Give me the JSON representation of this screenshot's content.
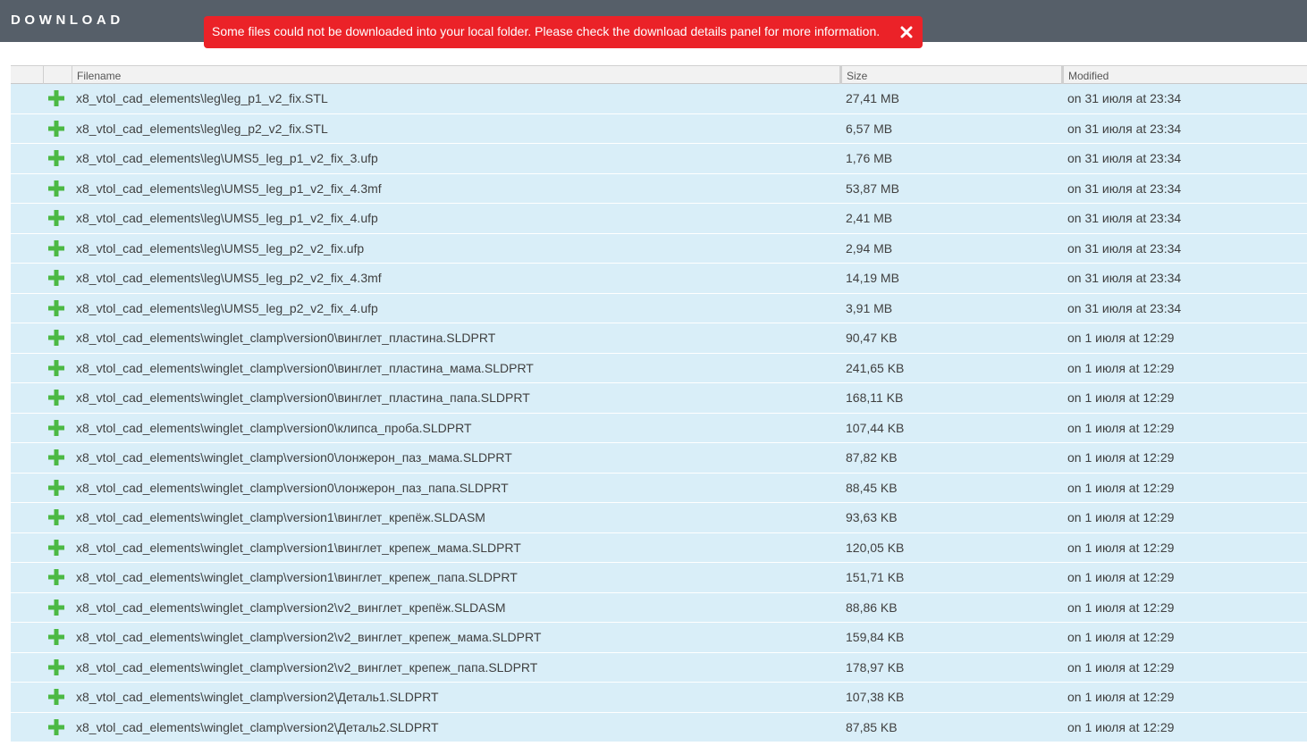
{
  "app": {
    "title": "DOWNLOAD"
  },
  "alert": {
    "message": "Some files could not be downloaded into your local folder. Please check the download details panel for more information.",
    "close_icon": "close-icon",
    "color": "#eb2228"
  },
  "table": {
    "columns": {
      "filename": "Filename",
      "size": "Size",
      "modified": "Modified"
    },
    "row_icon": "plus-icon",
    "accent": "#4cb944",
    "rows": [
      {
        "filename": "x8_vtol_cad_elements\\leg\\leg_p1_v2_fix.STL",
        "size": "27,41 MB",
        "modified": "on 31 июля at 23:34"
      },
      {
        "filename": "x8_vtol_cad_elements\\leg\\leg_p2_v2_fix.STL",
        "size": "6,57 MB",
        "modified": "on 31 июля at 23:34"
      },
      {
        "filename": "x8_vtol_cad_elements\\leg\\UMS5_leg_p1_v2_fix_3.ufp",
        "size": "1,76 MB",
        "modified": "on 31 июля at 23:34"
      },
      {
        "filename": "x8_vtol_cad_elements\\leg\\UMS5_leg_p1_v2_fix_4.3mf",
        "size": "53,87 MB",
        "modified": "on 31 июля at 23:34"
      },
      {
        "filename": "x8_vtol_cad_elements\\leg\\UMS5_leg_p1_v2_fix_4.ufp",
        "size": "2,41 MB",
        "modified": "on 31 июля at 23:34"
      },
      {
        "filename": "x8_vtol_cad_elements\\leg\\UMS5_leg_p2_v2_fix.ufp",
        "size": "2,94 MB",
        "modified": "on 31 июля at 23:34"
      },
      {
        "filename": "x8_vtol_cad_elements\\leg\\UMS5_leg_p2_v2_fix_4.3mf",
        "size": "14,19 MB",
        "modified": "on 31 июля at 23:34"
      },
      {
        "filename": "x8_vtol_cad_elements\\leg\\UMS5_leg_p2_v2_fix_4.ufp",
        "size": "3,91 MB",
        "modified": "on 31 июля at 23:34"
      },
      {
        "filename": "x8_vtol_cad_elements\\winglet_clamp\\version0\\винглет_пластина.SLDPRT",
        "size": "90,47 KB",
        "modified": "on 1 июля at 12:29"
      },
      {
        "filename": "x8_vtol_cad_elements\\winglet_clamp\\version0\\винглет_пластина_мама.SLDPRT",
        "size": "241,65 KB",
        "modified": "on 1 июля at 12:29"
      },
      {
        "filename": "x8_vtol_cad_elements\\winglet_clamp\\version0\\винглет_пластина_папа.SLDPRT",
        "size": "168,11 KB",
        "modified": "on 1 июля at 12:29"
      },
      {
        "filename": "x8_vtol_cad_elements\\winglet_clamp\\version0\\клипса_проба.SLDPRT",
        "size": "107,44 KB",
        "modified": "on 1 июля at 12:29"
      },
      {
        "filename": "x8_vtol_cad_elements\\winglet_clamp\\version0\\лонжерон_паз_мама.SLDPRT",
        "size": "87,82 KB",
        "modified": "on 1 июля at 12:29"
      },
      {
        "filename": "x8_vtol_cad_elements\\winglet_clamp\\version0\\лонжерон_паз_папа.SLDPRT",
        "size": "88,45 KB",
        "modified": "on 1 июля at 12:29"
      },
      {
        "filename": "x8_vtol_cad_elements\\winglet_clamp\\version1\\винглет_крепёж.SLDASM",
        "size": "93,63 KB",
        "modified": "on 1 июля at 12:29"
      },
      {
        "filename": "x8_vtol_cad_elements\\winglet_clamp\\version1\\винглет_крепеж_мама.SLDPRT",
        "size": "120,05 KB",
        "modified": "on 1 июля at 12:29"
      },
      {
        "filename": "x8_vtol_cad_elements\\winglet_clamp\\version1\\винглет_крепеж_папа.SLDPRT",
        "size": "151,71 KB",
        "modified": "on 1 июля at 12:29"
      },
      {
        "filename": "x8_vtol_cad_elements\\winglet_clamp\\version2\\v2_винглет_крепёж.SLDASM",
        "size": "88,86 KB",
        "modified": "on 1 июля at 12:29"
      },
      {
        "filename": "x8_vtol_cad_elements\\winglet_clamp\\version2\\v2_винглет_крепеж_мама.SLDPRT",
        "size": "159,84 KB",
        "modified": "on 1 июля at 12:29"
      },
      {
        "filename": "x8_vtol_cad_elements\\winglet_clamp\\version2\\v2_винглет_крепеж_папа.SLDPRT",
        "size": "178,97 KB",
        "modified": "on 1 июля at 12:29"
      },
      {
        "filename": "x8_vtol_cad_elements\\winglet_clamp\\version2\\Деталь1.SLDPRT",
        "size": "107,38 KB",
        "modified": "on 1 июля at 12:29"
      },
      {
        "filename": "x8_vtol_cad_elements\\winglet_clamp\\version2\\Деталь2.SLDPRT",
        "size": "87,85 KB",
        "modified": "on 1 июля at 12:29"
      }
    ]
  }
}
